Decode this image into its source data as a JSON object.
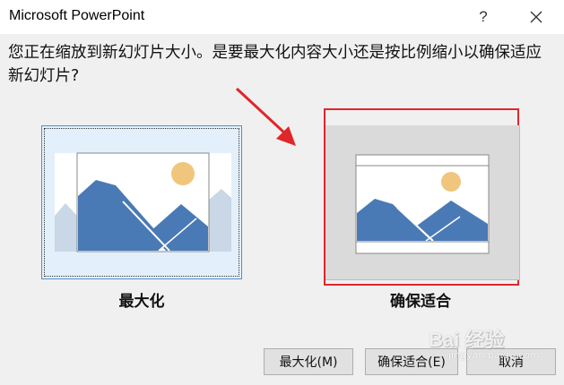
{
  "window": {
    "title": "Microsoft PowerPoint",
    "help_symbol": "?",
    "close_icon": "close-icon"
  },
  "message": "您正在缩放到新幻灯片大小。是要最大化内容大小还是按比例缩小以确保适应新幻灯片?",
  "options": [
    {
      "label": "最大化",
      "state": "selected"
    },
    {
      "label": "确保适合",
      "highlighted": true,
      "highlight_color": "#e0262a"
    }
  ],
  "buttons": {
    "maximize": "最大化(M)",
    "ensure_fit": "确保适合(E)",
    "cancel": "取消"
  },
  "watermark": {
    "text": "Bai 经验",
    "sub": "jingyan.baidu.com"
  },
  "colors": {
    "mountain": "#4a7ab5",
    "mountain_faded": "#c9d7e6",
    "sun": "#f0c67c",
    "selected_bg": "#e3f0fb",
    "fit_bg": "#dadada"
  }
}
